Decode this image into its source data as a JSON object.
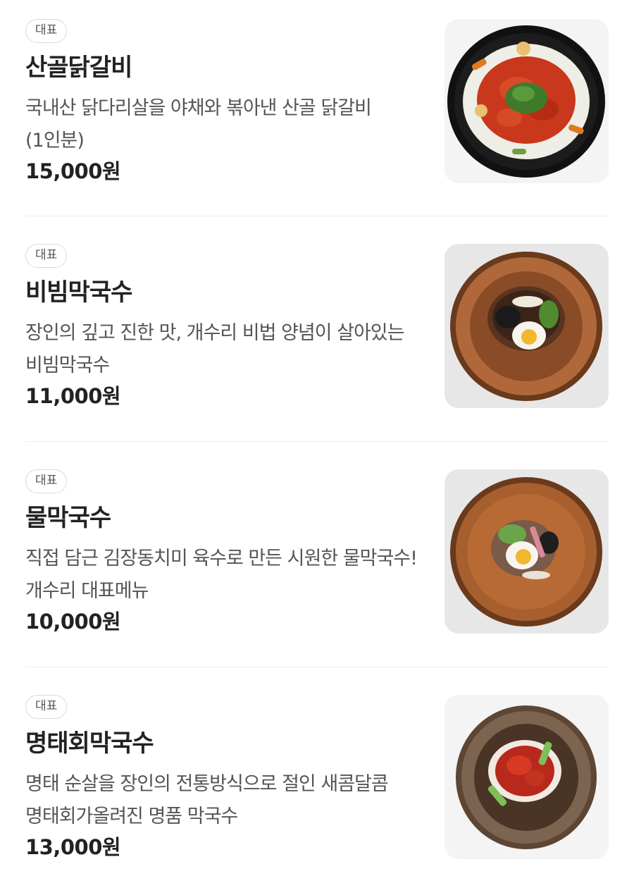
{
  "menu": {
    "items": [
      {
        "badge": "대표",
        "name": "산골닭갈비",
        "description": "국내산 닭다리살을 야채와 볶아낸 산골 닭갈비 (1인분)",
        "price": "15,000원"
      },
      {
        "badge": "대표",
        "name": "비빔막국수",
        "description": "장인의 깊고 진한 맛, 개수리 비법 양념이 살아있는 비빔막국수",
        "price": "11,000원"
      },
      {
        "badge": "대표",
        "name": "물막국수",
        "description": "직접 담근 김장동치미 육수로 만든 시원한 물막국수! 개수리 대표메뉴",
        "price": "10,000원"
      },
      {
        "badge": "대표",
        "name": "명태회막국수",
        "description": "명태 순살을 장인의 전통방식으로 절인 새콤달콤 명태회가올려진 명품 막국수",
        "price": "13,000원"
      }
    ]
  },
  "colors": {
    "text_primary": "#222222",
    "text_secondary": "#555555",
    "badge_border": "#d9d9d9",
    "divider": "#ececec"
  }
}
